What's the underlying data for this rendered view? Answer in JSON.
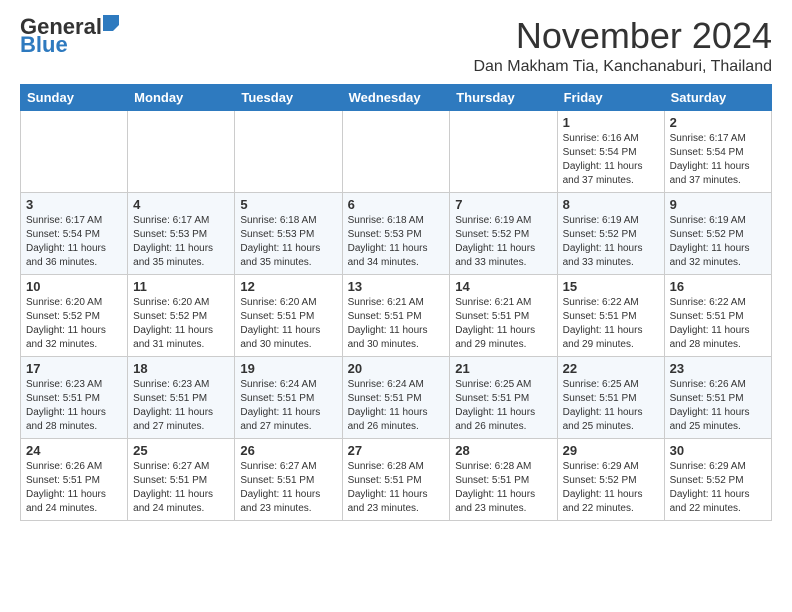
{
  "logo": {
    "general": "General",
    "blue": "Blue"
  },
  "header": {
    "month_title": "November 2024",
    "location": "Dan Makham Tia, Kanchanaburi, Thailand"
  },
  "weekdays": [
    "Sunday",
    "Monday",
    "Tuesday",
    "Wednesday",
    "Thursday",
    "Friday",
    "Saturday"
  ],
  "weeks": [
    [
      {
        "day": "",
        "info": ""
      },
      {
        "day": "",
        "info": ""
      },
      {
        "day": "",
        "info": ""
      },
      {
        "day": "",
        "info": ""
      },
      {
        "day": "",
        "info": ""
      },
      {
        "day": "1",
        "info": "Sunrise: 6:16 AM\nSunset: 5:54 PM\nDaylight: 11 hours and 37 minutes."
      },
      {
        "day": "2",
        "info": "Sunrise: 6:17 AM\nSunset: 5:54 PM\nDaylight: 11 hours and 37 minutes."
      }
    ],
    [
      {
        "day": "3",
        "info": "Sunrise: 6:17 AM\nSunset: 5:54 PM\nDaylight: 11 hours and 36 minutes."
      },
      {
        "day": "4",
        "info": "Sunrise: 6:17 AM\nSunset: 5:53 PM\nDaylight: 11 hours and 35 minutes."
      },
      {
        "day": "5",
        "info": "Sunrise: 6:18 AM\nSunset: 5:53 PM\nDaylight: 11 hours and 35 minutes."
      },
      {
        "day": "6",
        "info": "Sunrise: 6:18 AM\nSunset: 5:53 PM\nDaylight: 11 hours and 34 minutes."
      },
      {
        "day": "7",
        "info": "Sunrise: 6:19 AM\nSunset: 5:52 PM\nDaylight: 11 hours and 33 minutes."
      },
      {
        "day": "8",
        "info": "Sunrise: 6:19 AM\nSunset: 5:52 PM\nDaylight: 11 hours and 33 minutes."
      },
      {
        "day": "9",
        "info": "Sunrise: 6:19 AM\nSunset: 5:52 PM\nDaylight: 11 hours and 32 minutes."
      }
    ],
    [
      {
        "day": "10",
        "info": "Sunrise: 6:20 AM\nSunset: 5:52 PM\nDaylight: 11 hours and 32 minutes."
      },
      {
        "day": "11",
        "info": "Sunrise: 6:20 AM\nSunset: 5:52 PM\nDaylight: 11 hours and 31 minutes."
      },
      {
        "day": "12",
        "info": "Sunrise: 6:20 AM\nSunset: 5:51 PM\nDaylight: 11 hours and 30 minutes."
      },
      {
        "day": "13",
        "info": "Sunrise: 6:21 AM\nSunset: 5:51 PM\nDaylight: 11 hours and 30 minutes."
      },
      {
        "day": "14",
        "info": "Sunrise: 6:21 AM\nSunset: 5:51 PM\nDaylight: 11 hours and 29 minutes."
      },
      {
        "day": "15",
        "info": "Sunrise: 6:22 AM\nSunset: 5:51 PM\nDaylight: 11 hours and 29 minutes."
      },
      {
        "day": "16",
        "info": "Sunrise: 6:22 AM\nSunset: 5:51 PM\nDaylight: 11 hours and 28 minutes."
      }
    ],
    [
      {
        "day": "17",
        "info": "Sunrise: 6:23 AM\nSunset: 5:51 PM\nDaylight: 11 hours and 28 minutes."
      },
      {
        "day": "18",
        "info": "Sunrise: 6:23 AM\nSunset: 5:51 PM\nDaylight: 11 hours and 27 minutes."
      },
      {
        "day": "19",
        "info": "Sunrise: 6:24 AM\nSunset: 5:51 PM\nDaylight: 11 hours and 27 minutes."
      },
      {
        "day": "20",
        "info": "Sunrise: 6:24 AM\nSunset: 5:51 PM\nDaylight: 11 hours and 26 minutes."
      },
      {
        "day": "21",
        "info": "Sunrise: 6:25 AM\nSunset: 5:51 PM\nDaylight: 11 hours and 26 minutes."
      },
      {
        "day": "22",
        "info": "Sunrise: 6:25 AM\nSunset: 5:51 PM\nDaylight: 11 hours and 25 minutes."
      },
      {
        "day": "23",
        "info": "Sunrise: 6:26 AM\nSunset: 5:51 PM\nDaylight: 11 hours and 25 minutes."
      }
    ],
    [
      {
        "day": "24",
        "info": "Sunrise: 6:26 AM\nSunset: 5:51 PM\nDaylight: 11 hours and 24 minutes."
      },
      {
        "day": "25",
        "info": "Sunrise: 6:27 AM\nSunset: 5:51 PM\nDaylight: 11 hours and 24 minutes."
      },
      {
        "day": "26",
        "info": "Sunrise: 6:27 AM\nSunset: 5:51 PM\nDaylight: 11 hours and 23 minutes."
      },
      {
        "day": "27",
        "info": "Sunrise: 6:28 AM\nSunset: 5:51 PM\nDaylight: 11 hours and 23 minutes."
      },
      {
        "day": "28",
        "info": "Sunrise: 6:28 AM\nSunset: 5:51 PM\nDaylight: 11 hours and 23 minutes."
      },
      {
        "day": "29",
        "info": "Sunrise: 6:29 AM\nSunset: 5:52 PM\nDaylight: 11 hours and 22 minutes."
      },
      {
        "day": "30",
        "info": "Sunrise: 6:29 AM\nSunset: 5:52 PM\nDaylight: 11 hours and 22 minutes."
      }
    ]
  ]
}
